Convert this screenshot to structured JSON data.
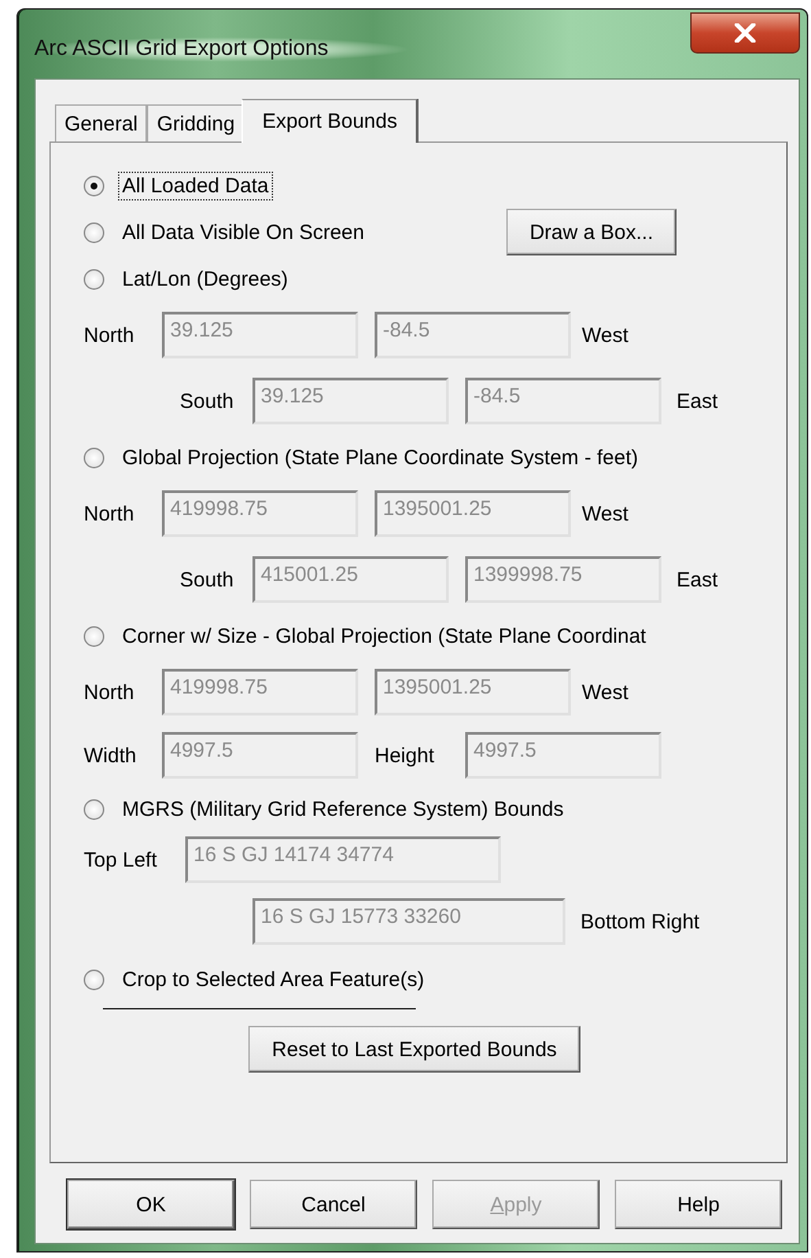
{
  "window": {
    "title": "Arc ASCII Grid Export Options"
  },
  "tabs": [
    {
      "label": "General",
      "selected": false
    },
    {
      "label": "Gridding",
      "selected": false
    },
    {
      "label": "Export Bounds",
      "selected": true
    }
  ],
  "options": [
    {
      "label": "All Loaded Data",
      "selected": true,
      "focused": true
    },
    {
      "label": "All Data Visible On Screen",
      "selected": false,
      "button": "Draw a Box..."
    },
    {
      "label": "Lat/Lon (Degrees)",
      "selected": false,
      "rows": [
        {
          "kind": "pair",
          "label": "North",
          "values": [
            "39.125",
            "-84.5"
          ],
          "end_label": "West",
          "disabled": true
        },
        {
          "kind": "offset",
          "label": "South",
          "values": [
            "39.125",
            "-84.5"
          ],
          "end_label": "East",
          "disabled": true
        }
      ]
    },
    {
      "label": "Global Projection (State Plane Coordinate System - feet)",
      "selected": false,
      "rows": [
        {
          "kind": "pair",
          "label": "North",
          "values": [
            "419998.75",
            "1395001.25"
          ],
          "end_label": "West",
          "disabled": true
        },
        {
          "kind": "offset",
          "label": "South",
          "values": [
            "415001.25",
            "1399998.75"
          ],
          "end_label": "East",
          "disabled": true
        }
      ]
    },
    {
      "label": "Corner w/ Size - Global Projection (State Plane Coordinat",
      "selected": false,
      "rows": [
        {
          "kind": "pair",
          "label": "North",
          "values": [
            "419998.75",
            "1395001.25"
          ],
          "end_label": "West",
          "disabled": true
        },
        {
          "kind": "split",
          "label": "Width",
          "values": [
            "4997.5",
            "4997.5"
          ],
          "mid_label": "Height",
          "disabled": true
        }
      ]
    },
    {
      "label": "MGRS (Military Grid Reference System) Bounds",
      "selected": false,
      "rows": [
        {
          "kind": "wide",
          "label": "Top Left",
          "values": [
            "16 S GJ 14174 34774"
          ],
          "disabled": true
        },
        {
          "kind": "wide-offset",
          "values": [
            "16 S GJ 15773 33260"
          ],
          "end_label": "Bottom Right",
          "disabled": true
        }
      ]
    },
    {
      "label": "Crop to Selected Area Feature(s)",
      "selected": false,
      "rule": true
    }
  ],
  "reset_button": "Reset to Last Exported Bounds",
  "buttons": [
    {
      "label": "OK",
      "default": true,
      "disabled": false,
      "underline_first": false
    },
    {
      "label": "Cancel",
      "default": false,
      "disabled": false,
      "underline_first": false
    },
    {
      "label": "Apply",
      "default": false,
      "disabled": true,
      "underline_first": true
    },
    {
      "label": "Help",
      "default": false,
      "disabled": false,
      "underline_first": false
    }
  ]
}
